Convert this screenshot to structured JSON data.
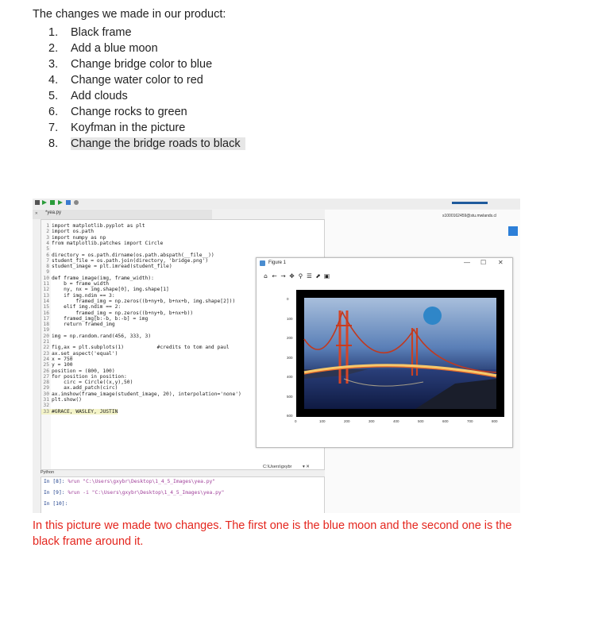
{
  "heading": "The changes we made in our product:",
  "changes": [
    "Black frame",
    "Add a blue moon",
    "Change bridge color to blue",
    "Change water color to red",
    "Add clouds",
    "Change rocks to green",
    "Koyfman in the picture",
    "Change the bridge roads to black"
  ],
  "screenshot": {
    "editor_tab": "*yea.py",
    "account": "s1000162459@stu.mwlands.cl",
    "code": [
      [
        "1",
        "import matplotlib.pyplot as plt"
      ],
      [
        "2",
        "import os.path"
      ],
      [
        "3",
        "import numpy as np"
      ],
      [
        "4",
        "from matplotlib.patches import Circle"
      ],
      [
        "5",
        ""
      ],
      [
        "6",
        "directory = os.path.dirname(os.path.abspath(__file__))"
      ],
      [
        "7",
        "student_file = os.path.join(directory, 'bridge.png')"
      ],
      [
        "8",
        "student_image = plt.imread(student_file)"
      ],
      [
        "9",
        ""
      ],
      [
        "10",
        "def frame_image(img, frame_width):"
      ],
      [
        "11",
        "    b = frame_width"
      ],
      [
        "12",
        "    ny, nx = img.shape[0], img.shape[1]"
      ],
      [
        "13",
        "    if img.ndim == 3:"
      ],
      [
        "14",
        "        framed_img = np.zeros((b+ny+b, b+nx+b, img.shape[2]))"
      ],
      [
        "15",
        "    elif img.ndim == 2:"
      ],
      [
        "16",
        "        framed_img = np.zeros((b+ny+b, b+nx+b))"
      ],
      [
        "17",
        "    framed_img[b:-b, b:-b] = img"
      ],
      [
        "18",
        "    return framed_img"
      ],
      [
        "19",
        ""
      ],
      [
        "20",
        "img = np.random.rand(456, 333, 3)"
      ],
      [
        "21",
        ""
      ],
      [
        "22",
        "fig,ax = plt.subplots(1)           #credits to tom and paul"
      ],
      [
        "23",
        "ax.set_aspect('equal')"
      ],
      [
        "24",
        "x = 750"
      ],
      [
        "25",
        "y = 100"
      ],
      [
        "26",
        "position = (800, 100)"
      ],
      [
        "27",
        "for position in position:"
      ],
      [
        "28",
        "    circ = Circle((x,y),50)"
      ],
      [
        "29",
        "    ax.add_patch(circ)"
      ],
      [
        "30",
        "ax.imshow(frame_image(student_image, 20), interpolation='none')"
      ],
      [
        "31",
        "plt.show()"
      ],
      [
        "32",
        ""
      ],
      [
        "33",
        "#GRACE, WASLEY, JUSTIN"
      ]
    ],
    "console_label": "Python",
    "console_path": "C:\\Users\\gxybr",
    "console_lines": [
      [
        "In [8]:",
        " %run \"C:\\Users\\gxybr\\Desktop\\1_4_5_Images\\yea.py\""
      ],
      [
        "In [9]:",
        " %run -i \"C:\\Users\\gxybr\\Desktop\\1_4_5_Images\\yea.py\""
      ],
      [
        "In [10]:",
        ""
      ]
    ],
    "figure_title": "Figure 1",
    "figure_controls": [
      "—",
      "☐",
      "✕"
    ],
    "figure_tools": [
      "⌂",
      "←",
      "→",
      "✥",
      "⚲",
      "☰",
      "⬈",
      "▣"
    ],
    "y_ticks": [
      "0",
      "100",
      "200",
      "300",
      "400",
      "500",
      "600"
    ],
    "x_ticks": [
      "0",
      "100",
      "200",
      "300",
      "400",
      "500",
      "600",
      "700",
      "800"
    ]
  },
  "caption": "In this picture we made two changes. The first one is the blue moon and the second one is the black frame around it.",
  "colors": {
    "caption": "#e4261e",
    "moon": "#2f86c8",
    "frame": "#000000"
  }
}
